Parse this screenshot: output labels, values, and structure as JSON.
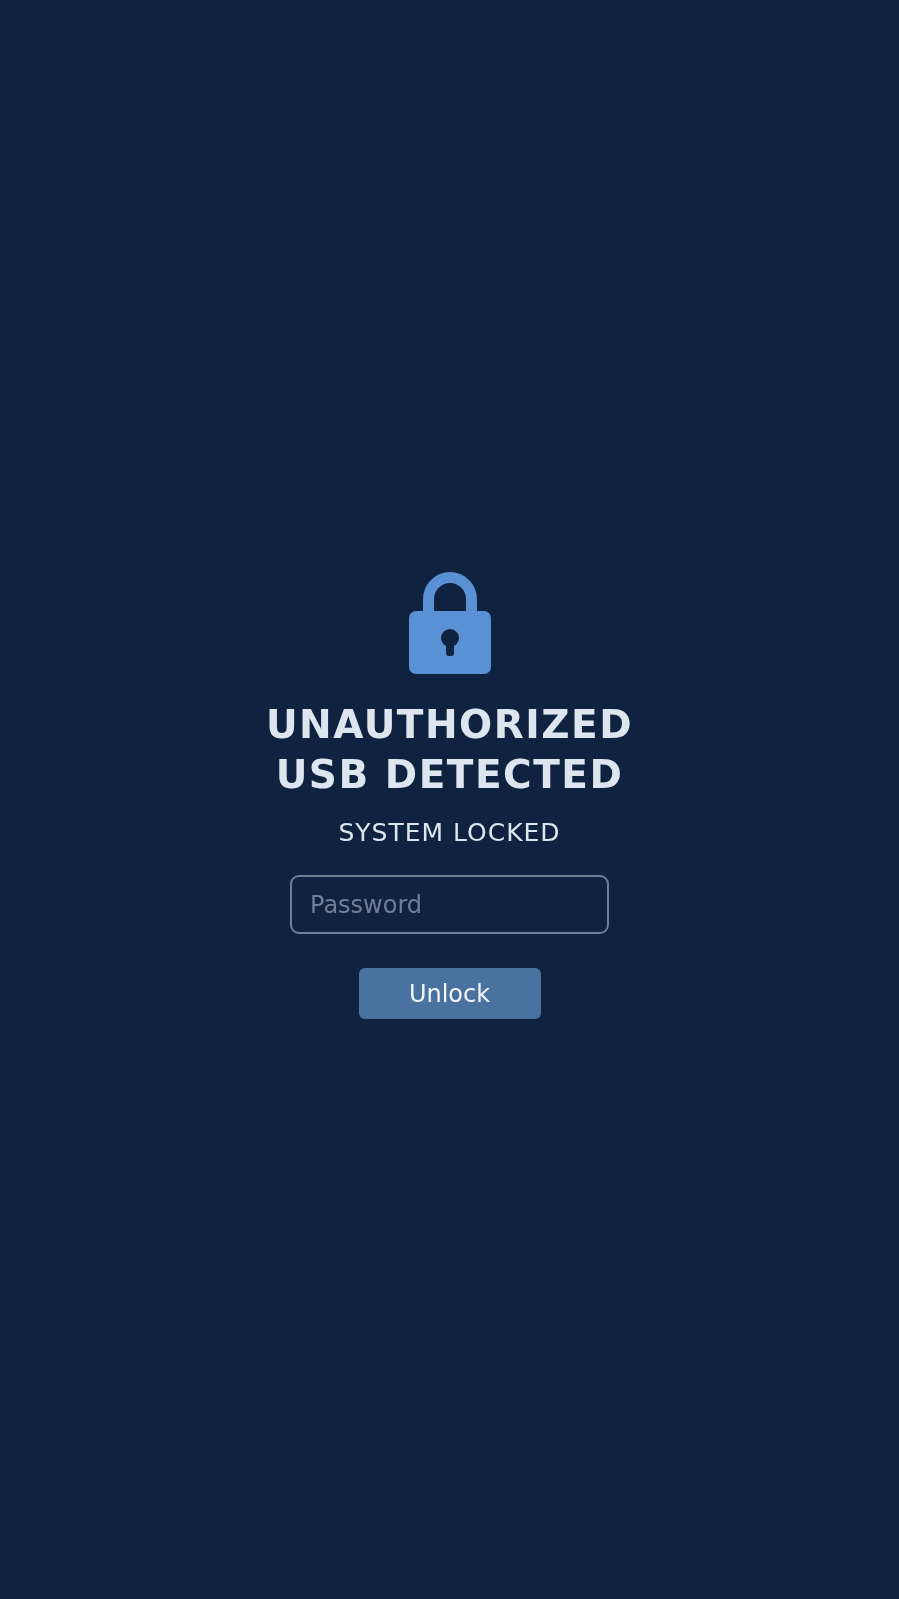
{
  "title": "UNAUTHORIZED\nUSB DETECTED",
  "subtitle": "SYSTEM LOCKED",
  "password_field": {
    "placeholder": "Password"
  },
  "buttons": [
    "Unlock"
  ]
}
